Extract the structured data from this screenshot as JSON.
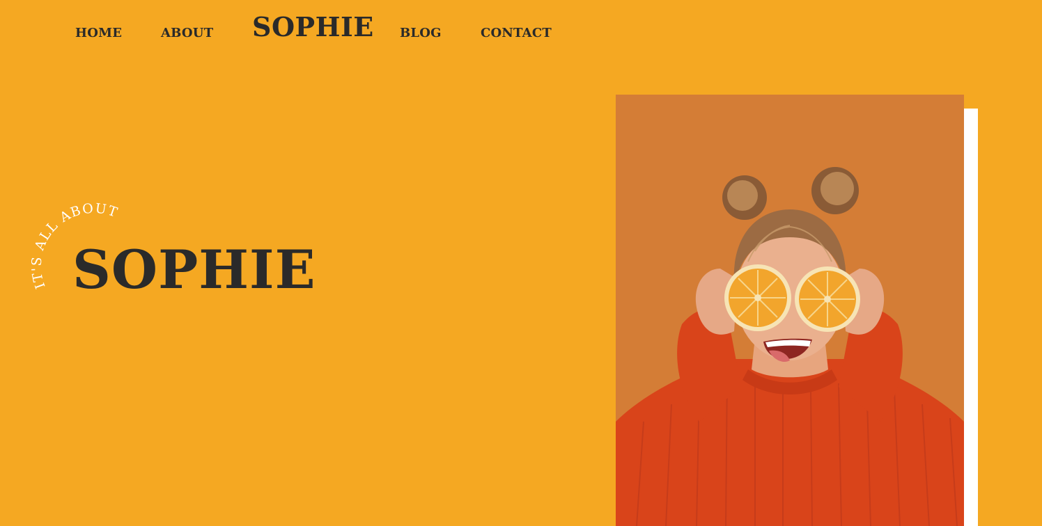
{
  "nav": {
    "home": "HOME",
    "about": "ABOUT",
    "logo": "SOPHIE",
    "blog": "BLOG",
    "contact": "CONTACT"
  },
  "hero": {
    "tagline": "IT'S ALL ABOUT",
    "title": "SOPHIE",
    "photo_alt": "Woman in an orange sweater holding orange halves over her eyes"
  },
  "colors": {
    "background": "#F5A822",
    "text": "#2A2A2A",
    "tagline": "#FFFFFF",
    "photo_backdrop": "#D47D36",
    "sweater": "#D9441A"
  }
}
